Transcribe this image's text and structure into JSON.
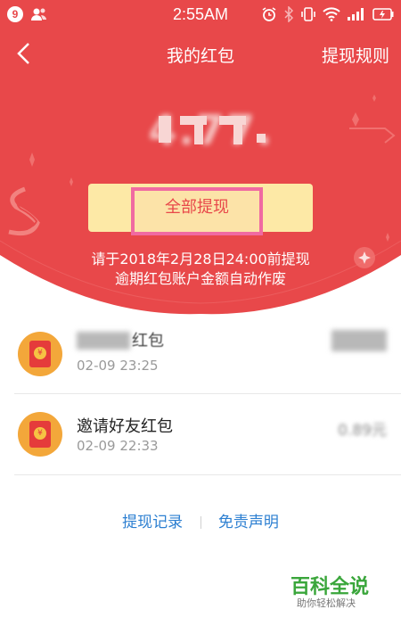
{
  "status_bar": {
    "notification_count": "9",
    "time": "2:55AM"
  },
  "nav": {
    "title": "我的红包",
    "right_link": "提现规则"
  },
  "balance": {
    "amount": "4.77."
  },
  "withdraw": {
    "button_label": "全部提现",
    "notice_line1": "请于2018年2月28日24:00前提现",
    "notice_line2": "逾期红包账户金额自动作废"
  },
  "records": [
    {
      "title": "红包",
      "time": "02-09 23:25",
      "amount": ""
    },
    {
      "title": "邀请好友红包",
      "time": "02-09 22:33",
      "amount": "0.89元"
    }
  ],
  "footer_links": {
    "history": "提现记录",
    "disclaimer": "免责声明"
  },
  "watermark": {
    "title": "百科全说",
    "subtitle": "助你轻松解决"
  },
  "colors": {
    "primary_red": "#e8484a",
    "button_yellow": "#fde9a6",
    "highlight_pink": "#f06aa1",
    "link_blue": "#2c7fd1"
  }
}
